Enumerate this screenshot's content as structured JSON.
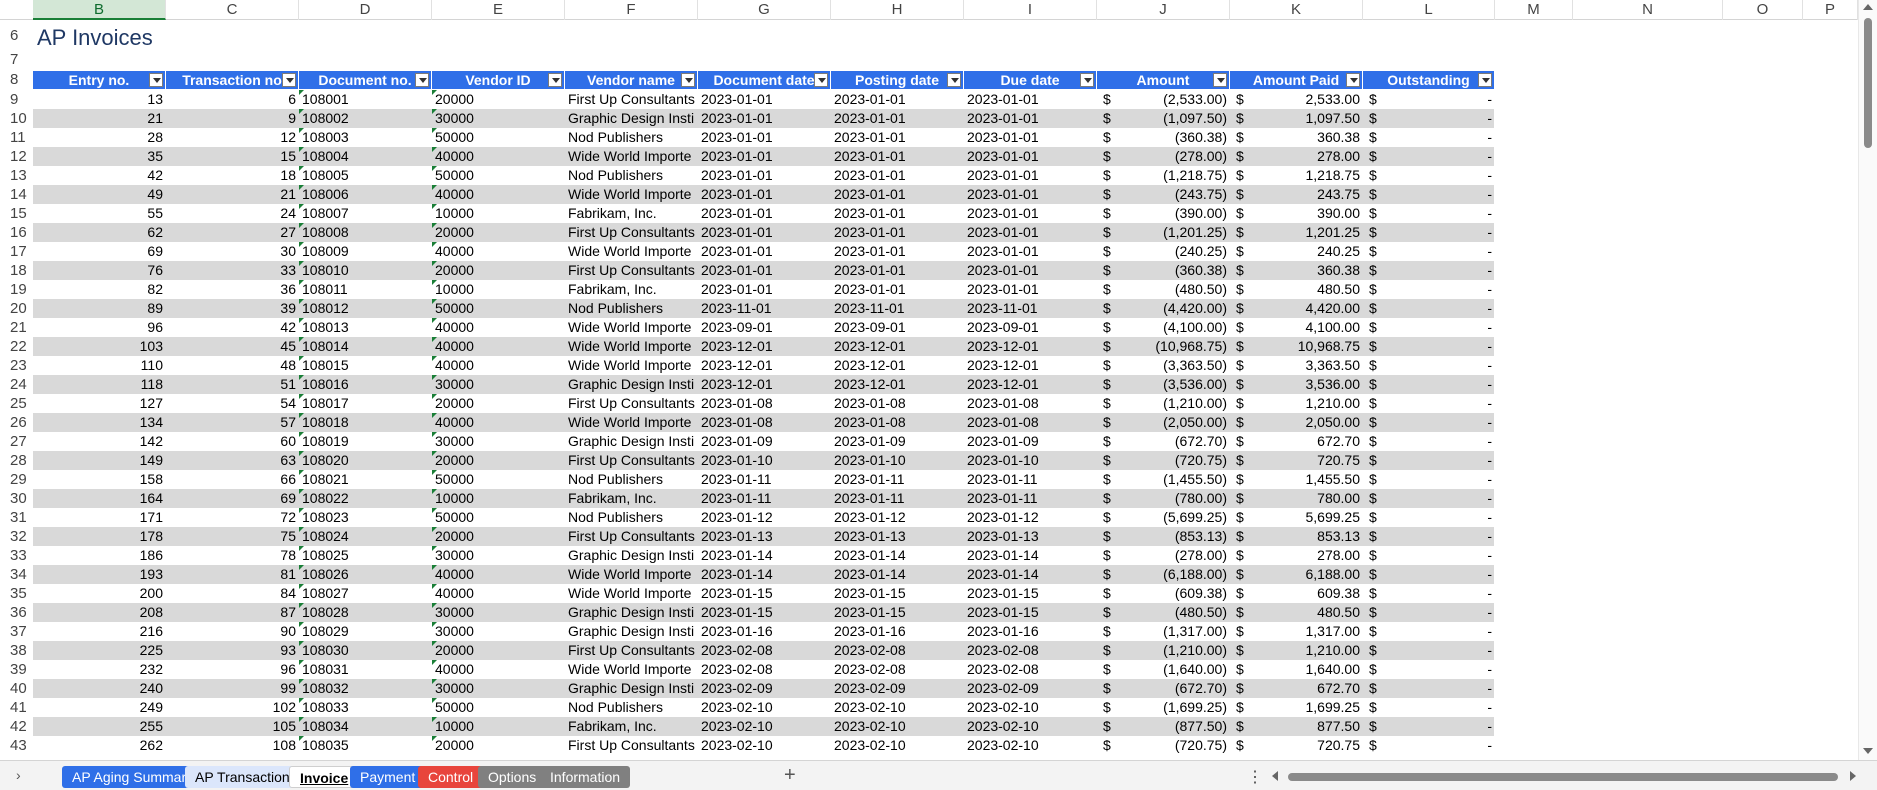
{
  "sheet_title": "AP Invoices",
  "column_letters": [
    "B",
    "C",
    "D",
    "E",
    "F",
    "G",
    "H",
    "I",
    "J",
    "K",
    "L",
    "M",
    "N",
    "O",
    "P"
  ],
  "selected_column": "B",
  "header_row_numbers": [
    "6",
    "7",
    "8"
  ],
  "table_headers": [
    "Entry no.",
    "Transaction no",
    "Document no.",
    "Vendor ID",
    "Vendor name",
    "Document date",
    "Posting date",
    "Due date",
    "Amount",
    "Amount Paid",
    "Outstanding"
  ],
  "currency_symbol": "$",
  "rows": [
    {
      "n": "9",
      "entry": "13",
      "txn": "6",
      "doc": "108001",
      "vid": "20000",
      "vname": "First Up Consultants",
      "ddate": "2023-01-01",
      "pdate": "2023-01-01",
      "due": "2023-01-01",
      "amount": "(2,533.00)",
      "paid": "2,533.00",
      "out": "-"
    },
    {
      "n": "10",
      "entry": "21",
      "txn": "9",
      "doc": "108002",
      "vid": "30000",
      "vname": "Graphic Design Insti",
      "ddate": "2023-01-01",
      "pdate": "2023-01-01",
      "due": "2023-01-01",
      "amount": "(1,097.50)",
      "paid": "1,097.50",
      "out": "-"
    },
    {
      "n": "11",
      "entry": "28",
      "txn": "12",
      "doc": "108003",
      "vid": "50000",
      "vname": "Nod Publishers",
      "ddate": "2023-01-01",
      "pdate": "2023-01-01",
      "due": "2023-01-01",
      "amount": "(360.38)",
      "paid": "360.38",
      "out": "-"
    },
    {
      "n": "12",
      "entry": "35",
      "txn": "15",
      "doc": "108004",
      "vid": "40000",
      "vname": "Wide World Importe",
      "ddate": "2023-01-01",
      "pdate": "2023-01-01",
      "due": "2023-01-01",
      "amount": "(278.00)",
      "paid": "278.00",
      "out": "-"
    },
    {
      "n": "13",
      "entry": "42",
      "txn": "18",
      "doc": "108005",
      "vid": "50000",
      "vname": "Nod Publishers",
      "ddate": "2023-01-01",
      "pdate": "2023-01-01",
      "due": "2023-01-01",
      "amount": "(1,218.75)",
      "paid": "1,218.75",
      "out": "-"
    },
    {
      "n": "14",
      "entry": "49",
      "txn": "21",
      "doc": "108006",
      "vid": "40000",
      "vname": "Wide World Importe",
      "ddate": "2023-01-01",
      "pdate": "2023-01-01",
      "due": "2023-01-01",
      "amount": "(243.75)",
      "paid": "243.75",
      "out": "-"
    },
    {
      "n": "15",
      "entry": "55",
      "txn": "24",
      "doc": "108007",
      "vid": "10000",
      "vname": "Fabrikam, Inc.",
      "ddate": "2023-01-01",
      "pdate": "2023-01-01",
      "due": "2023-01-01",
      "amount": "(390.00)",
      "paid": "390.00",
      "out": "-"
    },
    {
      "n": "16",
      "entry": "62",
      "txn": "27",
      "doc": "108008",
      "vid": "20000",
      "vname": "First Up Consultants",
      "ddate": "2023-01-01",
      "pdate": "2023-01-01",
      "due": "2023-01-01",
      "amount": "(1,201.25)",
      "paid": "1,201.25",
      "out": "-"
    },
    {
      "n": "17",
      "entry": "69",
      "txn": "30",
      "doc": "108009",
      "vid": "40000",
      "vname": "Wide World Importe",
      "ddate": "2023-01-01",
      "pdate": "2023-01-01",
      "due": "2023-01-01",
      "amount": "(240.25)",
      "paid": "240.25",
      "out": "-"
    },
    {
      "n": "18",
      "entry": "76",
      "txn": "33",
      "doc": "108010",
      "vid": "20000",
      "vname": "First Up Consultants",
      "ddate": "2023-01-01",
      "pdate": "2023-01-01",
      "due": "2023-01-01",
      "amount": "(360.38)",
      "paid": "360.38",
      "out": "-"
    },
    {
      "n": "19",
      "entry": "82",
      "txn": "36",
      "doc": "108011",
      "vid": "10000",
      "vname": "Fabrikam, Inc.",
      "ddate": "2023-01-01",
      "pdate": "2023-01-01",
      "due": "2023-01-01",
      "amount": "(480.50)",
      "paid": "480.50",
      "out": "-"
    },
    {
      "n": "20",
      "entry": "89",
      "txn": "39",
      "doc": "108012",
      "vid": "50000",
      "vname": "Nod Publishers",
      "ddate": "2023-11-01",
      "pdate": "2023-11-01",
      "due": "2023-11-01",
      "amount": "(4,420.00)",
      "paid": "4,420.00",
      "out": "-"
    },
    {
      "n": "21",
      "entry": "96",
      "txn": "42",
      "doc": "108013",
      "vid": "40000",
      "vname": "Wide World Importe",
      "ddate": "2023-09-01",
      "pdate": "2023-09-01",
      "due": "2023-09-01",
      "amount": "(4,100.00)",
      "paid": "4,100.00",
      "out": "-"
    },
    {
      "n": "22",
      "entry": "103",
      "txn": "45",
      "doc": "108014",
      "vid": "40000",
      "vname": "Wide World Importe",
      "ddate": "2023-12-01",
      "pdate": "2023-12-01",
      "due": "2023-12-01",
      "amount": "(10,968.75)",
      "paid": "10,968.75",
      "out": "-"
    },
    {
      "n": "23",
      "entry": "110",
      "txn": "48",
      "doc": "108015",
      "vid": "40000",
      "vname": "Wide World Importe",
      "ddate": "2023-12-01",
      "pdate": "2023-12-01",
      "due": "2023-12-01",
      "amount": "(3,363.50)",
      "paid": "3,363.50",
      "out": "-"
    },
    {
      "n": "24",
      "entry": "118",
      "txn": "51",
      "doc": "108016",
      "vid": "30000",
      "vname": "Graphic Design Insti",
      "ddate": "2023-12-01",
      "pdate": "2023-12-01",
      "due": "2023-12-01",
      "amount": "(3,536.00)",
      "paid": "3,536.00",
      "out": "-"
    },
    {
      "n": "25",
      "entry": "127",
      "txn": "54",
      "doc": "108017",
      "vid": "20000",
      "vname": "First Up Consultants",
      "ddate": "2023-01-08",
      "pdate": "2023-01-08",
      "due": "2023-01-08",
      "amount": "(1,210.00)",
      "paid": "1,210.00",
      "out": "-"
    },
    {
      "n": "26",
      "entry": "134",
      "txn": "57",
      "doc": "108018",
      "vid": "40000",
      "vname": "Wide World Importe",
      "ddate": "2023-01-08",
      "pdate": "2023-01-08",
      "due": "2023-01-08",
      "amount": "(2,050.00)",
      "paid": "2,050.00",
      "out": "-"
    },
    {
      "n": "27",
      "entry": "142",
      "txn": "60",
      "doc": "108019",
      "vid": "30000",
      "vname": "Graphic Design Insti",
      "ddate": "2023-01-09",
      "pdate": "2023-01-09",
      "due": "2023-01-09",
      "amount": "(672.70)",
      "paid": "672.70",
      "out": "-"
    },
    {
      "n": "28",
      "entry": "149",
      "txn": "63",
      "doc": "108020",
      "vid": "20000",
      "vname": "First Up Consultants",
      "ddate": "2023-01-10",
      "pdate": "2023-01-10",
      "due": "2023-01-10",
      "amount": "(720.75)",
      "paid": "720.75",
      "out": "-"
    },
    {
      "n": "29",
      "entry": "158",
      "txn": "66",
      "doc": "108021",
      "vid": "50000",
      "vname": "Nod Publishers",
      "ddate": "2023-01-11",
      "pdate": "2023-01-11",
      "due": "2023-01-11",
      "amount": "(1,455.50)",
      "paid": "1,455.50",
      "out": "-"
    },
    {
      "n": "30",
      "entry": "164",
      "txn": "69",
      "doc": "108022",
      "vid": "10000",
      "vname": "Fabrikam, Inc.",
      "ddate": "2023-01-11",
      "pdate": "2023-01-11",
      "due": "2023-01-11",
      "amount": "(780.00)",
      "paid": "780.00",
      "out": "-"
    },
    {
      "n": "31",
      "entry": "171",
      "txn": "72",
      "doc": "108023",
      "vid": "50000",
      "vname": "Nod Publishers",
      "ddate": "2023-01-12",
      "pdate": "2023-01-12",
      "due": "2023-01-12",
      "amount": "(5,699.25)",
      "paid": "5,699.25",
      "out": "-"
    },
    {
      "n": "32",
      "entry": "178",
      "txn": "75",
      "doc": "108024",
      "vid": "20000",
      "vname": "First Up Consultants",
      "ddate": "2023-01-13",
      "pdate": "2023-01-13",
      "due": "2023-01-13",
      "amount": "(853.13)",
      "paid": "853.13",
      "out": "-"
    },
    {
      "n": "33",
      "entry": "186",
      "txn": "78",
      "doc": "108025",
      "vid": "30000",
      "vname": "Graphic Design Insti",
      "ddate": "2023-01-14",
      "pdate": "2023-01-14",
      "due": "2023-01-14",
      "amount": "(278.00)",
      "paid": "278.00",
      "out": "-"
    },
    {
      "n": "34",
      "entry": "193",
      "txn": "81",
      "doc": "108026",
      "vid": "40000",
      "vname": "Wide World Importe",
      "ddate": "2023-01-14",
      "pdate": "2023-01-14",
      "due": "2023-01-14",
      "amount": "(6,188.00)",
      "paid": "6,188.00",
      "out": "-"
    },
    {
      "n": "35",
      "entry": "200",
      "txn": "84",
      "doc": "108027",
      "vid": "40000",
      "vname": "Wide World Importe",
      "ddate": "2023-01-15",
      "pdate": "2023-01-15",
      "due": "2023-01-15",
      "amount": "(609.38)",
      "paid": "609.38",
      "out": "-"
    },
    {
      "n": "36",
      "entry": "208",
      "txn": "87",
      "doc": "108028",
      "vid": "30000",
      "vname": "Graphic Design Insti",
      "ddate": "2023-01-15",
      "pdate": "2023-01-15",
      "due": "2023-01-15",
      "amount": "(480.50)",
      "paid": "480.50",
      "out": "-"
    },
    {
      "n": "37",
      "entry": "216",
      "txn": "90",
      "doc": "108029",
      "vid": "30000",
      "vname": "Graphic Design Insti",
      "ddate": "2023-01-16",
      "pdate": "2023-01-16",
      "due": "2023-01-16",
      "amount": "(1,317.00)",
      "paid": "1,317.00",
      "out": "-"
    },
    {
      "n": "38",
      "entry": "225",
      "txn": "93",
      "doc": "108030",
      "vid": "20000",
      "vname": "First Up Consultants",
      "ddate": "2023-02-08",
      "pdate": "2023-02-08",
      "due": "2023-02-08",
      "amount": "(1,210.00)",
      "paid": "1,210.00",
      "out": "-"
    },
    {
      "n": "39",
      "entry": "232",
      "txn": "96",
      "doc": "108031",
      "vid": "40000",
      "vname": "Wide World Importe",
      "ddate": "2023-02-08",
      "pdate": "2023-02-08",
      "due": "2023-02-08",
      "amount": "(1,640.00)",
      "paid": "1,640.00",
      "out": "-"
    },
    {
      "n": "40",
      "entry": "240",
      "txn": "99",
      "doc": "108032",
      "vid": "30000",
      "vname": "Graphic Design Insti",
      "ddate": "2023-02-09",
      "pdate": "2023-02-09",
      "due": "2023-02-09",
      "amount": "(672.70)",
      "paid": "672.70",
      "out": "-"
    },
    {
      "n": "41",
      "entry": "249",
      "txn": "102",
      "doc": "108033",
      "vid": "50000",
      "vname": "Nod Publishers",
      "ddate": "2023-02-10",
      "pdate": "2023-02-10",
      "due": "2023-02-10",
      "amount": "(1,699.25)",
      "paid": "1,699.25",
      "out": "-"
    },
    {
      "n": "42",
      "entry": "255",
      "txn": "105",
      "doc": "108034",
      "vid": "10000",
      "vname": "Fabrikam, Inc.",
      "ddate": "2023-02-10",
      "pdate": "2023-02-10",
      "due": "2023-02-10",
      "amount": "(877.50)",
      "paid": "877.50",
      "out": "-"
    },
    {
      "n": "43",
      "entry": "262",
      "txn": "108",
      "doc": "108035",
      "vid": "20000",
      "vname": "First Up Consultants",
      "ddate": "2023-02-10",
      "pdate": "2023-02-10",
      "due": "2023-02-10",
      "amount": "(720.75)",
      "paid": "720.75",
      "out": "-"
    }
  ],
  "sheet_tabs": [
    {
      "label": "AP Aging Summary",
      "bg": "#2f6fe8",
      "fg": "#ffffff",
      "active": false
    },
    {
      "label": "AP Transactions",
      "bg": "#dbe6fb",
      "fg": "#000000",
      "active": false
    },
    {
      "label": "Invoice",
      "bg": "#dbe6fb",
      "fg": "#000000",
      "active": true
    },
    {
      "label": "Payment",
      "bg": "#2f6fe8",
      "fg": "#ffffff",
      "active": false
    },
    {
      "label": "Control",
      "bg": "#e8453c",
      "fg": "#ffffff",
      "active": false
    },
    {
      "label": "Options",
      "bg": "#808080",
      "fg": "#ffffff",
      "active": false
    },
    {
      "label": "Information",
      "bg": "#808080",
      "fg": "#ffffff",
      "active": false
    }
  ],
  "tab_nav_glyph": "›",
  "add_sheet_glyph": "+",
  "more_glyph": "⋮",
  "colors": {
    "header_bg": "#2f6fe8",
    "title": "#1f3864",
    "band": "#d9d9d9",
    "selected_col": "#d3e7d6"
  }
}
